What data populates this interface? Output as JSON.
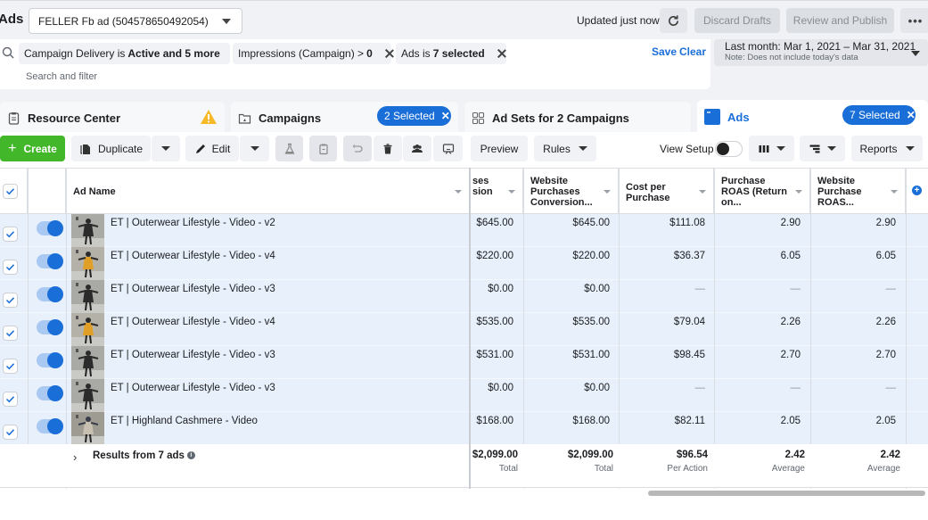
{
  "app_title": "Ads",
  "account_select": {
    "value": "FELLER Fb ad (504578650492054)"
  },
  "status": {
    "updated": "Updated just now"
  },
  "top_buttons": {
    "discard": "Discard Drafts",
    "publish": "Review and Publish",
    "more": "•••"
  },
  "filters": {
    "chips": [
      {
        "prefix": "Campaign Delivery is",
        "bold": "Active and 5 more"
      },
      {
        "prefix": "Impressions (Campaign) >",
        "bold": "0"
      },
      {
        "prefix": "Ads is",
        "bold": "7 selected"
      }
    ],
    "save": "Save",
    "clear": "Clear",
    "search_placeholder": "Search and filter"
  },
  "date_range": {
    "label": "Last month: Mar 1, 2021 – Mar 31, 2021",
    "note": "Note: Does not include today's data"
  },
  "tabs": {
    "resource_center": {
      "label": "Resource Center",
      "warning": true
    },
    "campaigns": {
      "label": "Campaigns",
      "selected": "2 Selected"
    },
    "adsets": {
      "label": "Ad Sets for 2 Campaigns"
    },
    "ads": {
      "label": "Ads",
      "selected": "7 Selected",
      "active": true
    }
  },
  "toolbar": {
    "create": "Create",
    "duplicate": "Duplicate",
    "edit": "Edit",
    "preview": "Preview",
    "rules": "Rules",
    "view_setup": "View Setup",
    "view_setup_on": false,
    "reports": "Reports"
  },
  "table": {
    "columns": {
      "ad_name": "Ad Name",
      "purchases_value_partial": "ses\nsion",
      "website_purchases_conv": "Website Purchases Conversion...",
      "cost_per_purchase": "Cost per Purchase",
      "purchase_roas": "Purchase ROAS (Return on...",
      "website_purchase_roas": "Website Purchase ROAS..."
    },
    "rows": [
      {
        "name": "ET | Outerwear Lifestyle - Video - v2",
        "on": true,
        "selected": true,
        "conv_value": "$645.00",
        "website_conv": "$645.00",
        "cpp": "$111.08",
        "roas": "2.90",
        "web_roas": "2.90"
      },
      {
        "name": "ET | Outerwear Lifestyle - Video - v4",
        "on": true,
        "selected": true,
        "conv_value": "$220.00",
        "website_conv": "$220.00",
        "cpp": "$36.37",
        "roas": "6.05",
        "web_roas": "6.05"
      },
      {
        "name": "ET | Outerwear Lifestyle - Video - v3",
        "on": true,
        "selected": true,
        "conv_value": "$0.00",
        "website_conv": "$0.00",
        "cpp": "—",
        "roas": "—",
        "web_roas": "—"
      },
      {
        "name": "ET | Outerwear Lifestyle - Video - v4",
        "on": true,
        "selected": true,
        "conv_value": "$535.00",
        "website_conv": "$535.00",
        "cpp": "$79.04",
        "roas": "2.26",
        "web_roas": "2.26"
      },
      {
        "name": "ET | Outerwear Lifestyle - Video - v3",
        "on": true,
        "selected": true,
        "conv_value": "$531.00",
        "website_conv": "$531.00",
        "cpp": "$98.45",
        "roas": "2.70",
        "web_roas": "2.70"
      },
      {
        "name": "ET | Outerwear Lifestyle - Video - v3",
        "on": true,
        "selected": true,
        "conv_value": "$0.00",
        "website_conv": "$0.00",
        "cpp": "—",
        "roas": "—",
        "web_roas": "—"
      },
      {
        "name": "ET | Highland Cashmere - Video",
        "on": true,
        "selected": true,
        "conv_value": "$168.00",
        "website_conv": "$168.00",
        "cpp": "$82.11",
        "roas": "2.05",
        "web_roas": "2.05"
      }
    ],
    "totals": {
      "label": "Results from 7 ads",
      "conv_value": "$2,099.00",
      "conv_value_sub": "Total",
      "website_conv": "$2,099.00",
      "website_conv_sub": "Total",
      "cpp": "$96.54",
      "cpp_sub": "Per Action",
      "roas": "2.42",
      "roas_sub": "Average",
      "web_roas": "2.42",
      "web_roas_sub": "Average"
    }
  }
}
